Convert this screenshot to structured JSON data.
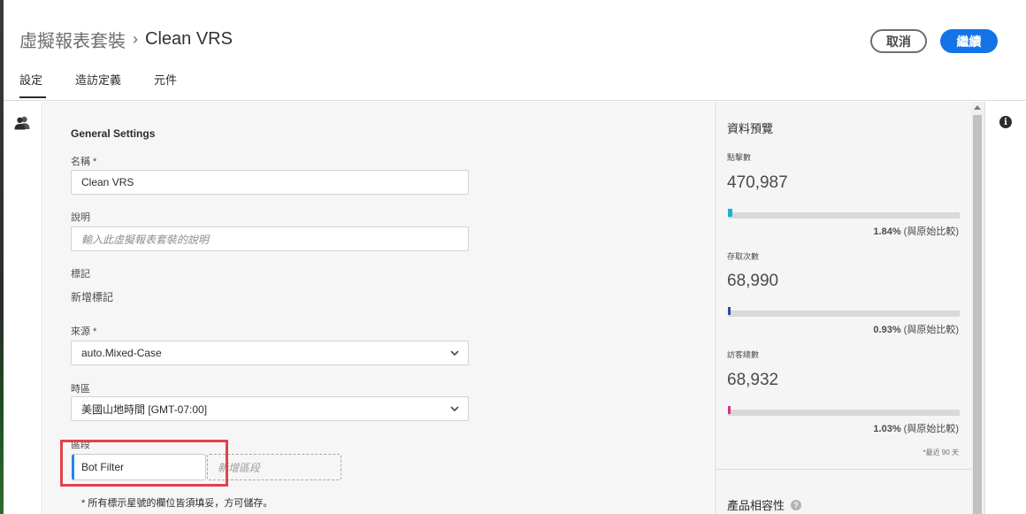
{
  "header": {
    "breadcrumb_root": "虛擬報表套裝",
    "breadcrumb_separator": "›",
    "breadcrumb_current": "Clean VRS",
    "cancel_label": "取消",
    "continue_label": "繼續"
  },
  "tabs": [
    {
      "label": "設定",
      "active": true
    },
    {
      "label": "造訪定義",
      "active": false
    },
    {
      "label": "元件",
      "active": false
    }
  ],
  "left_rail": {
    "icon": "users-icon"
  },
  "form": {
    "section_title": "General Settings",
    "name_label": "名稱 *",
    "name_value": "Clean VRS",
    "description_label": "說明",
    "description_placeholder": "輸入此虛擬報表套裝的說明",
    "tags_label": "標記",
    "tags_add": "新增標記",
    "source_label": "來源 *",
    "source_value": "auto.Mixed-Case",
    "timezone_label": "時區",
    "timezone_value": "美國山地時間 [GMT-07:00]",
    "segments_label": "區段",
    "segment_value": "Bot Filter",
    "segment_add_placeholder": "新增區段",
    "footnote": "* 所有標示星號的欄位皆須填妥，方可儲存。"
  },
  "preview": {
    "title": "資料預覽",
    "metrics": [
      {
        "label": "點擊數",
        "value": "470,987",
        "percent_text": "1.84%",
        "percent": 1.84,
        "compare": "(與原始比較)",
        "color": "#1ab4d4"
      },
      {
        "label": "存取次數",
        "value": "68,990",
        "percent_text": "0.93%",
        "percent": 0.93,
        "compare": "(與原始比較)",
        "color": "#2d4f9e"
      },
      {
        "label": "訪客總數",
        "value": "68,932",
        "percent_text": "1.03%",
        "percent": 1.03,
        "compare": "(與原始比較)",
        "color": "#d6338a"
      }
    ],
    "range_note": "*最近 90 天",
    "compat_title": "產品相容性"
  },
  "colors": {
    "accent": "#1473e6",
    "highlight": "#e0434a"
  }
}
